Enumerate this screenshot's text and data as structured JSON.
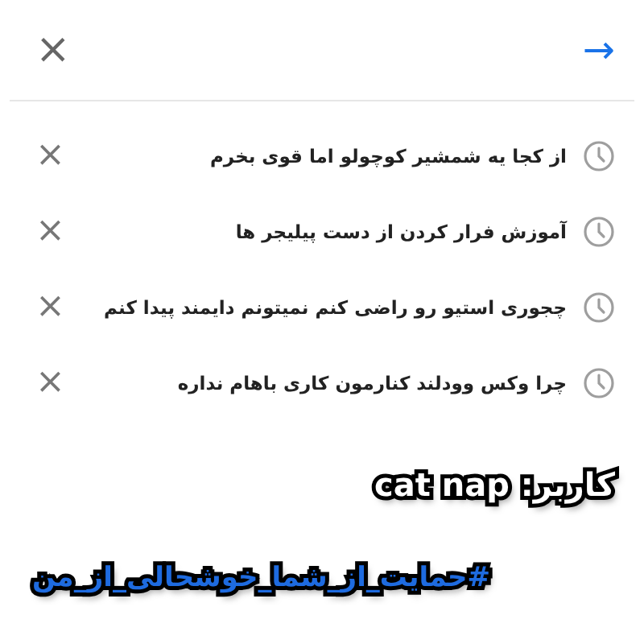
{
  "search_bar": {
    "clear": "×",
    "submit": "→"
  },
  "history": [
    {
      "query": "از کجا یه شمشیر کوچولو اما قوی بخرم",
      "remove": "×"
    },
    {
      "query": "آموزش فرار کردن از دست پیلیجر ها",
      "remove": "×"
    },
    {
      "query": "چجوری استیو رو راضی کنم نمیتونم دایمند پیدا کنم",
      "remove": "×"
    },
    {
      "query": "چرا وکس وودلند کنارمون کاری باهام نداره",
      "remove": "×"
    }
  ],
  "caption": {
    "user": "کاربر: cat nap",
    "hashtag": "#حمایت_از_شما_خوشحالی_از_من"
  }
}
